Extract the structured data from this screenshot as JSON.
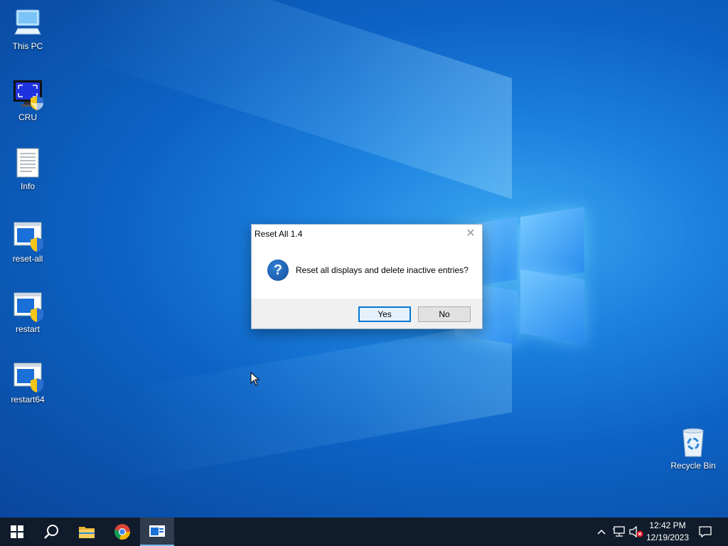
{
  "desktop": {
    "icons": [
      {
        "label": "This PC",
        "icon": "this-pc-icon"
      },
      {
        "label": "CRU",
        "icon": "cru-monitor-icon"
      },
      {
        "label": "Info",
        "icon": "text-document-icon"
      },
      {
        "label": "reset-all",
        "icon": "shielded-app-icon"
      },
      {
        "label": "restart",
        "icon": "shielded-app-icon"
      },
      {
        "label": "restart64",
        "icon": "shielded-app-icon"
      }
    ],
    "recycle_bin": {
      "label": "Recycle Bin",
      "icon": "recycle-bin-icon"
    }
  },
  "dialog": {
    "title": "Reset All 1.4",
    "message": "Reset all displays and delete inactive entries?",
    "icon": "question-icon",
    "question_glyph": "?",
    "close_glyph": "✕",
    "buttons": {
      "yes": "Yes",
      "no": "No"
    }
  },
  "taskbar": {
    "items": [
      "start-icon",
      "search-icon",
      "file-explorer-icon",
      "chrome-icon",
      "active-app-icon"
    ],
    "tray": [
      "chevron-up-icon",
      "network-icon",
      "volume-muted-icon",
      "notifications-icon"
    ],
    "clock": {
      "time": "12:42 PM",
      "date": "12/19/2023"
    }
  },
  "colors": {
    "accent": "#0078d7",
    "taskbar": "#101c2b",
    "desktop": "#0d62c4"
  }
}
